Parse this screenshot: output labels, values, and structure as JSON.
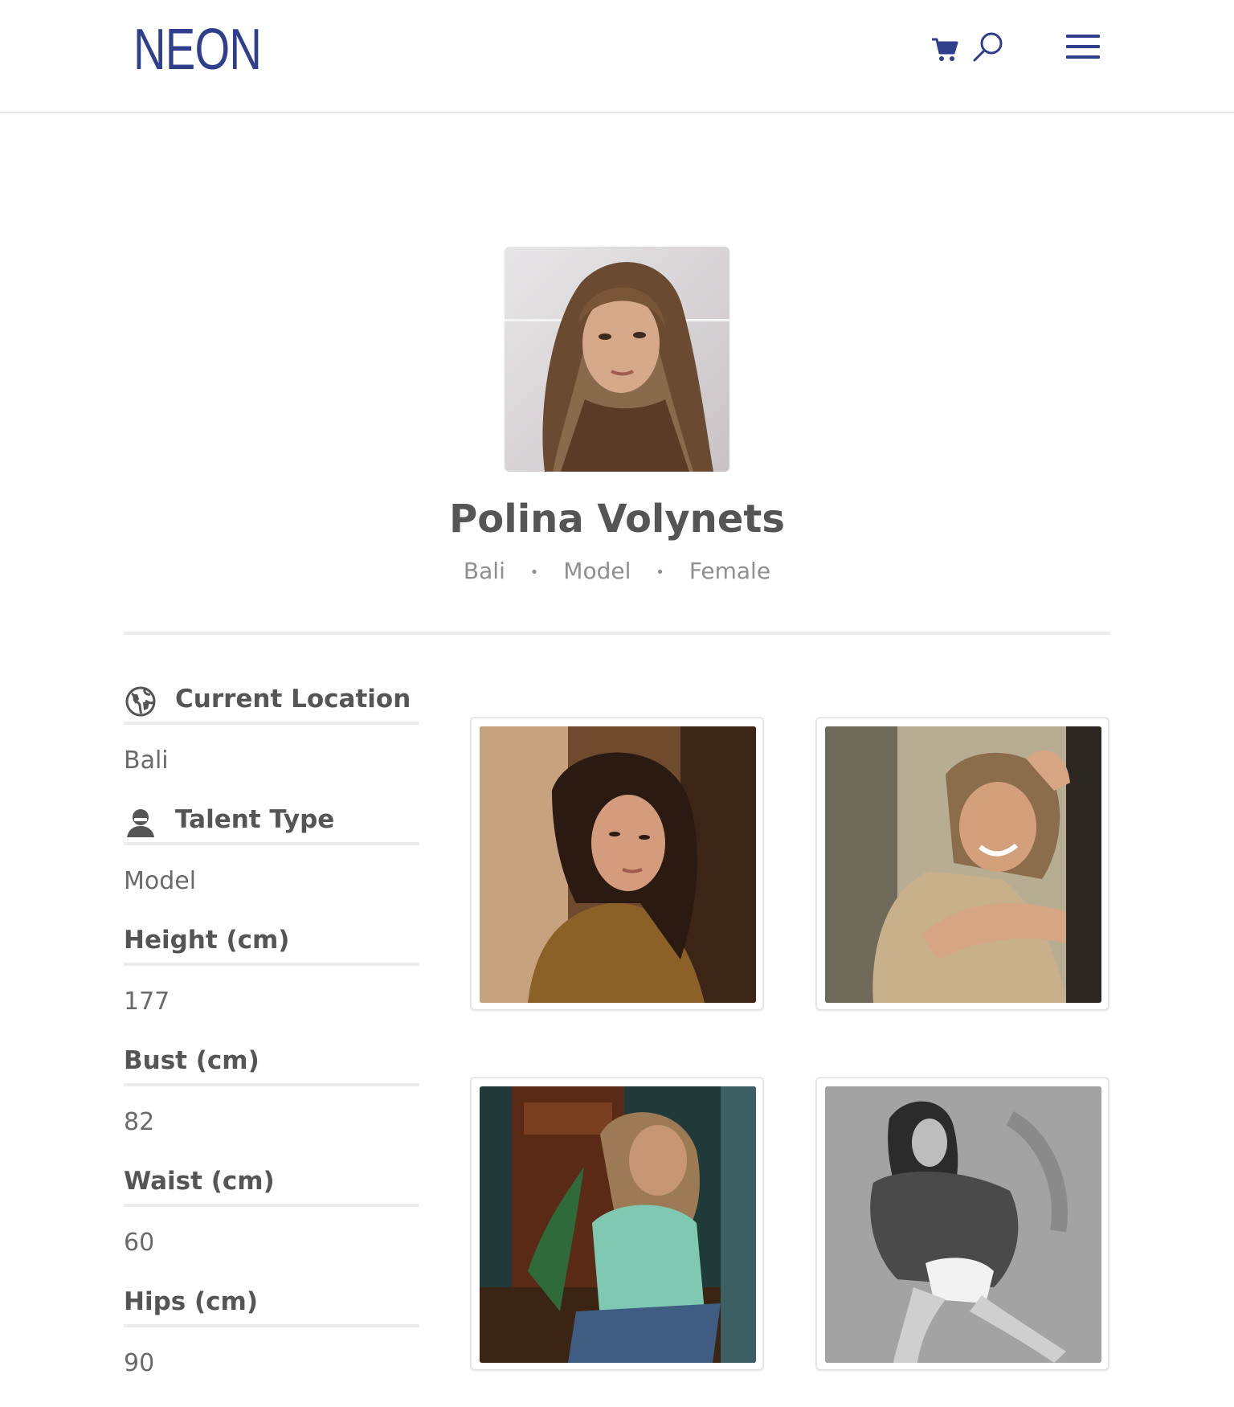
{
  "header": {
    "logo": "NEON",
    "icons": [
      "cart-icon",
      "search-icon",
      "hamburger-menu-icon"
    ],
    "brand_color": "#2f3f8c"
  },
  "profile": {
    "name": "Polina Volynets",
    "meta": [
      "Bali",
      "Model",
      "Female"
    ]
  },
  "attributes": {
    "location": {
      "label": "Current Location",
      "value": "Bali",
      "icon": "globe-icon"
    },
    "talent": {
      "label": "Talent Type",
      "value": "Model",
      "icon": "person-icon"
    },
    "height": {
      "label": "Height (cm)",
      "value": "177"
    },
    "bust": {
      "label": "Bust (cm)",
      "value": "82"
    },
    "waist": {
      "label": "Waist (cm)",
      "value": "60"
    },
    "hips": {
      "label": "Hips (cm)",
      "value": "90"
    }
  },
  "gallery": [
    "portrait in brown sweater",
    "smiling in knit tank top",
    "posing in mint sweater",
    "black and white in fur coat"
  ]
}
